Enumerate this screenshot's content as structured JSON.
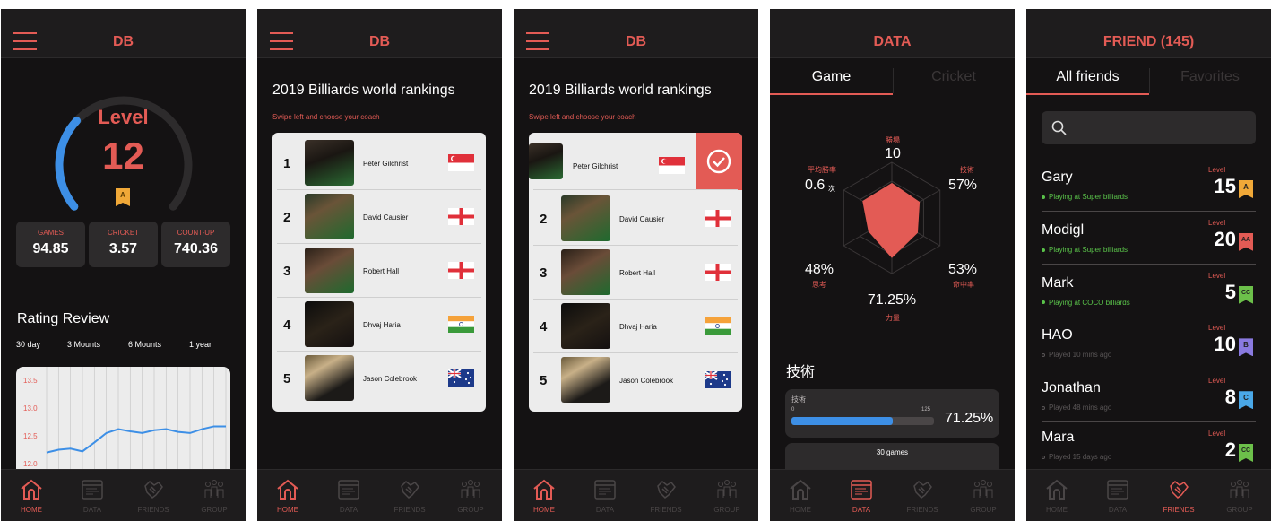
{
  "nav": {
    "home": "HOME",
    "data": "DATA",
    "friends": "FRIENDS",
    "group": "GROUP"
  },
  "screen1": {
    "title": "DB",
    "level_label": "Level",
    "level": "12",
    "level_badge": "A",
    "level_progress": 0.32,
    "stats": [
      {
        "label": "GAMES",
        "value": "94.85"
      },
      {
        "label": "CRICKET",
        "value": "3.57"
      },
      {
        "label": "COUNT-UP",
        "value": "740.36"
      }
    ],
    "rating_title": "Rating Review",
    "periods": [
      "30 day",
      "3 Mounts",
      "6 Mounts",
      "1 year"
    ],
    "chart_data": {
      "type": "line",
      "y_ticks": [
        "13.5",
        "13.0",
        "12.5",
        "12.0"
      ],
      "ylim": [
        12.0,
        13.5
      ],
      "values": [
        12.2,
        12.25,
        12.27,
        12.22,
        12.38,
        12.55,
        12.62,
        12.58,
        12.55,
        12.6,
        12.62,
        12.57,
        12.55,
        12.62,
        12.67,
        12.67
      ],
      "grid": true
    }
  },
  "screen2": {
    "title": "DB",
    "heading": "2019 Billiards world rankings",
    "subheading": "Swipe left and choose your coach",
    "players": [
      {
        "rank": "1",
        "name": "Peter Gilchrist",
        "flag": "singapore"
      },
      {
        "rank": "2",
        "name": "David Causier",
        "flag": "england"
      },
      {
        "rank": "3",
        "name": "Robert Hall",
        "flag": "england"
      },
      {
        "rank": "4",
        "name": "Dhvaj Haria",
        "flag": "india"
      },
      {
        "rank": "5",
        "name": "Jason Colebrook",
        "flag": "australia"
      }
    ]
  },
  "screen3": {
    "title": "DB",
    "heading": "2019 Billiards world rankings",
    "subheading": "Swipe left and choose your coach",
    "selected_icon": "check-circle-icon"
  },
  "screen4": {
    "title": "DATA",
    "tabs": [
      "Game",
      "Cricket"
    ],
    "radar": [
      {
        "label": "勝場",
        "value": "10"
      },
      {
        "label": "技術",
        "value": "57%"
      },
      {
        "label": "命中率",
        "value": "53%"
      },
      {
        "label": "力量",
        "value": "71.25%"
      },
      {
        "label": "思考",
        "value": "48%"
      },
      {
        "label": "平均勝率",
        "value": "0.6",
        "unit": "次"
      }
    ],
    "skill_title": "技術",
    "skill_label": "技術",
    "skill_min": "0",
    "skill_max": "125",
    "skill_value": "71.25%",
    "skill_fraction": 0.7125,
    "games": "30 games"
  },
  "screen5": {
    "title": "FRIEND (145)",
    "tabs": [
      "All friends",
      "Favorites"
    ],
    "friends": [
      {
        "name": "Gary",
        "status": "Playing at Super billiards",
        "online": true,
        "level_label": "Level",
        "level": "15",
        "badge": "A",
        "badge_color": "#f0a838"
      },
      {
        "name": "Modigl",
        "status": "Playing at Super billiards",
        "online": true,
        "level_label": "Level",
        "level": "20",
        "badge": "AA",
        "badge_color": "#e35b55"
      },
      {
        "name": "Mark",
        "status": "Playing at COCO billiards",
        "online": true,
        "level_label": "Level",
        "level": "5",
        "badge": "CC",
        "badge_color": "#6cc04a"
      },
      {
        "name": "HAO",
        "status": "Played 10 mins ago",
        "online": false,
        "level_label": "Level",
        "level": "10",
        "badge": "B",
        "badge_color": "#8a7ae0"
      },
      {
        "name": "Jonathan",
        "status": "Played 48 mins ago",
        "online": false,
        "level_label": "Level",
        "level": "8",
        "badge": "C",
        "badge_color": "#4aa8e8"
      },
      {
        "name": "Mara",
        "status": "Played 15 days ago",
        "online": false,
        "level_label": "Level",
        "level": "2",
        "badge": "CC",
        "badge_color": "#6cc04a"
      }
    ]
  },
  "colors": {
    "accent": "#e35b55",
    "online": "#5ac34a",
    "chart_line": "#3d8fe6"
  }
}
